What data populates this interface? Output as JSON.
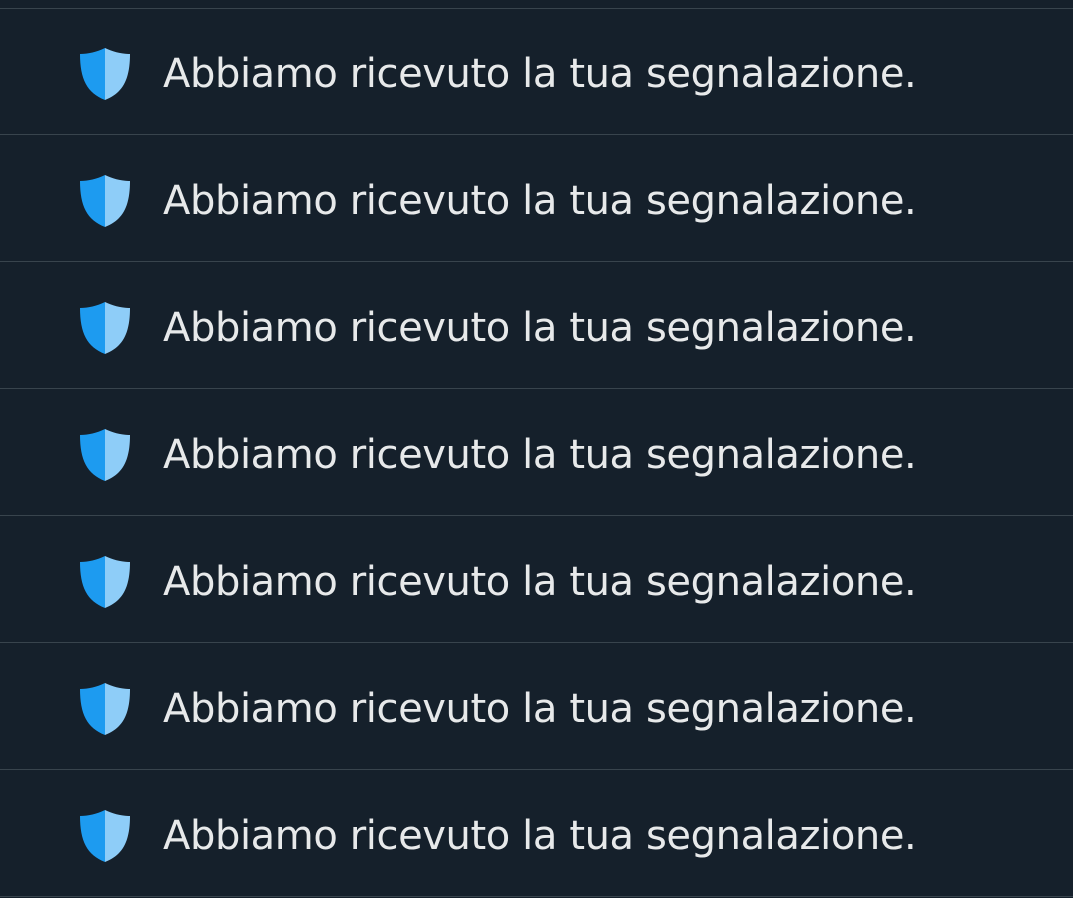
{
  "notifications": [
    {
      "icon": "shield-icon",
      "text": "Abbiamo ricevuto la tua segnalazione."
    },
    {
      "icon": "shield-icon",
      "text": "Abbiamo ricevuto la tua segnalazione."
    },
    {
      "icon": "shield-icon",
      "text": "Abbiamo ricevuto la tua segnalazione."
    },
    {
      "icon": "shield-icon",
      "text": "Abbiamo ricevuto la tua segnalazione."
    },
    {
      "icon": "shield-icon",
      "text": "Abbiamo ricevuto la tua segnalazione."
    },
    {
      "icon": "shield-icon",
      "text": "Abbiamo ricevuto la tua segnalazione."
    },
    {
      "icon": "shield-icon",
      "text": "Abbiamo ricevuto la tua segnalazione."
    }
  ],
  "colors": {
    "background": "#15202b",
    "divider": "#38444d",
    "text": "#e7e9ea",
    "shield_dark": "#1d9bf0",
    "shield_light": "#8ecdf8"
  }
}
